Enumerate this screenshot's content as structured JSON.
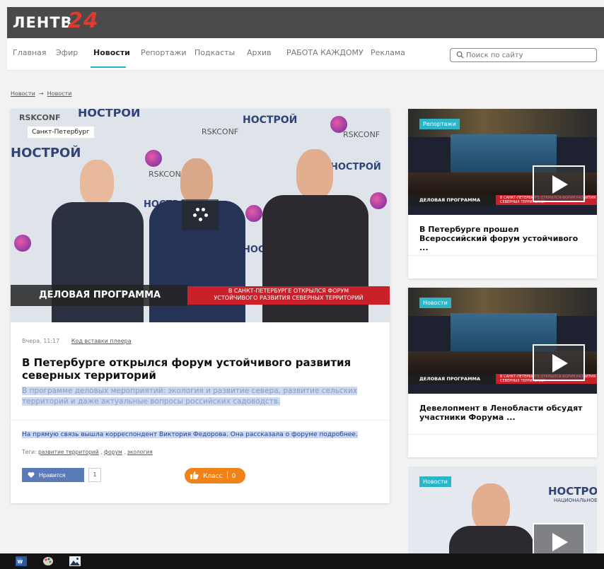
{
  "header": {
    "logo_text": "ЛЕНТВ",
    "logo_number": "24"
  },
  "nav": {
    "items": [
      "Главная",
      "Эфир",
      "Новости",
      "Репортажи",
      "Подкасты",
      "Архив",
      "РАБОТА КАЖДОМУ",
      "Реклама"
    ],
    "active": "Новости",
    "search_placeholder": "Поиск по сайту"
  },
  "breadcrumb": [
    "Новости",
    "Новости"
  ],
  "article": {
    "city": "Санкт-Петербург",
    "video": {
      "program_label": "ДЕЛОВАЯ ПРОГРАММА",
      "caption_line1": "В САНКТ-ПЕТЕРБУРГЕ ОТКРЫЛСЯ ФОРУМ",
      "caption_line2": "УСТОЙЧИВОГО РАЗВИТИЯ СЕВЕРНЫХ ТЕРРИТОРИЙ",
      "bg_logo": "НОСТРОЙ",
      "bg_logo_sub": "НАЦИОНАЛЬНОЕ",
      "bg_rsk": "RSKCONF"
    },
    "time": "Вчера, 11:17",
    "embed_link": "Код вставки плеера",
    "headline": "В Петербурге открылся форум устойчивого развития северных территорий",
    "lead": "В программе деловых мероприятий: экология и развитие севера, развитие сельских территорий и даже актуальные вопросы российских садоводств.",
    "body": "На прямую связь вышла корреспондент Виктория Федорова. Она рассказала о форуме подробнее.",
    "tags_label": "Теги:",
    "tags": [
      "развитие территорий",
      "форум",
      "экология"
    ],
    "like_label": "Нравится",
    "like_count": "1",
    "ok_label": "Класс",
    "ok_count": "0"
  },
  "side_cards": [
    {
      "tag": "Репортажи",
      "title": "В Петербурге прошел Всероссийский форум устойчивого ...",
      "strip_left": "ДЕЛОВАЯ ПРОГРАММА",
      "strip_right": "В САНКТ-ПЕТЕРБУРГЕ ОТКРЫЛСЯ ФОРУМ РАЗВИТИЯ СЕВЕРНЫХ ТЕРРИТОРИЙ"
    },
    {
      "tag": "Новости",
      "title": "Девелопмент в Ленобласти обсудят участники Форума ...",
      "strip_left": "ДЕЛОВАЯ ПРОГРАММА",
      "strip_right": "В САНКТ-ПЕТЕРБУРГЕ ОТКРЫЛСЯ ФОРУМ РАЗВИТИЯ СЕВЕРНЫХ ТЕРРИТОРИЙ"
    },
    {
      "tag": "Новости",
      "logo": "НОСТРОЙ",
      "logo_sub": "НАЦИОНАЛЬНОЕ"
    }
  ],
  "colors": {
    "accent": "#2bb5c7",
    "logo_red": "#e03a2c",
    "caption_red": "#c9202a",
    "ok_orange": "#f0821a",
    "like_blue": "#5a7ab8"
  },
  "taskbar": {
    "icons": [
      "word-icon",
      "paint-icon",
      "photos-icon"
    ]
  }
}
